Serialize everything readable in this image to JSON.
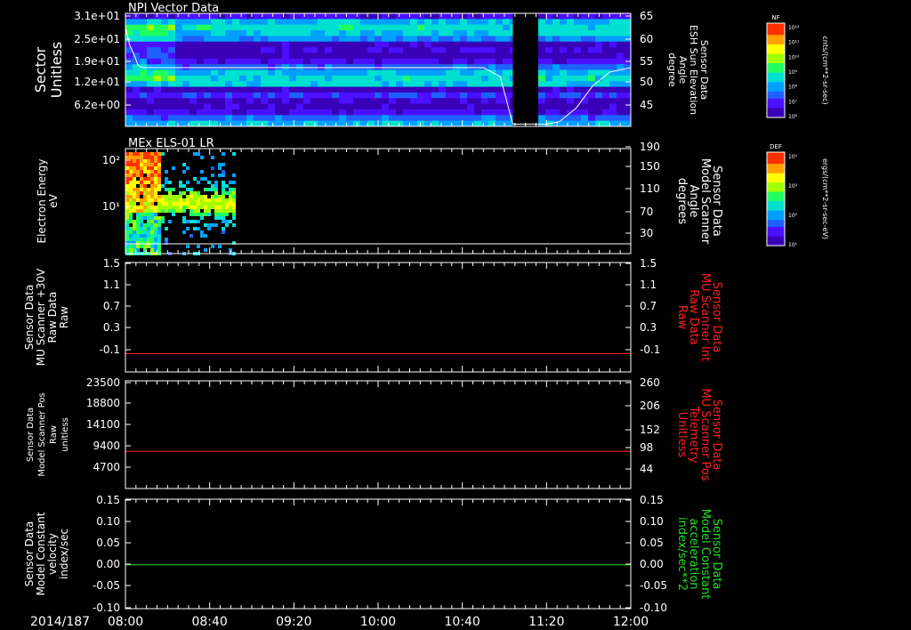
{
  "chart_data": [
    {
      "type": "heatmap",
      "title": "NPI Vector Data",
      "ylabel": "Sector\nUnitless",
      "yticks": [
        "3.1e+01",
        "2.5e+01",
        "1.9e+01",
        "1.2e+01",
        "6.2e+00"
      ],
      "y2label": "Sensor Data\nESH Sun Elevation\nAngle\ndegree",
      "y2ticks": [
        "65",
        "60",
        "55",
        "50",
        "45"
      ],
      "colorbar": {
        "label": "NF",
        "units": "cnts/(cm**2-sr-sec)",
        "ticks": [
          "10¹²",
          "10¹¹",
          "10¹⁰",
          "10⁹",
          "10⁸",
          "10⁷",
          "10⁶"
        ]
      },
      "data_gap": {
        "start": "11:04",
        "end": "11:14"
      },
      "overlay_line": {
        "name": "ESH Sun Elevation Angle",
        "x": [
          "08:00",
          "08:02",
          "08:04",
          "08:06",
          "08:08",
          "10:50",
          "10:58",
          "11:04",
          "11:14",
          "11:20",
          "11:26",
          "11:34",
          "11:42",
          "11:50",
          "12:00"
        ],
        "y": [
          62,
          58,
          56,
          53.5,
          53,
          53,
          51,
          40.5,
          40.5,
          40.5,
          41,
          44,
          49,
          52,
          53
        ]
      }
    },
    {
      "type": "heatmap",
      "title": "MEx ELS-01 LR",
      "ylabel": "Electron Energy\neV",
      "yticks": [
        "10²",
        "10¹"
      ],
      "y2label": "Sensor Data\nModel Scanner\nAngle\ndegrees",
      "y2ticks": [
        "190",
        "150",
        "110",
        "70",
        "30"
      ],
      "colorbar": {
        "label": "DEF",
        "units": "ergs/(cm**2-sr-sec-eV)",
        "ticks": [
          "10⁴",
          "10³",
          "10²",
          "10¹"
        ]
      },
      "data_extent": {
        "start": "08:00",
        "end": "08:52"
      },
      "overlay_line": {
        "name": "Model Scanner Angle",
        "x": [
          "08:00",
          "12:00"
        ],
        "y": [
          14,
          14
        ]
      }
    },
    {
      "type": "line",
      "ylabel": "Sensor Data\nMU Scanner +30V\nRaw Data\nRaw",
      "yticks": [
        "1.5",
        "1.1",
        "0.7",
        "0.3",
        "-0.1"
      ],
      "ylim": [
        -0.3,
        1.5
      ],
      "y2label": "Sensor Data\nMU Scanner Int\nRaw Data\nRaw",
      "y2ticks": [
        "1.5",
        "1.1",
        "0.7",
        "0.3",
        "-0.1"
      ],
      "series": [
        {
          "color": "#ff2020",
          "x": [
            "08:00",
            "12:00"
          ],
          "y": [
            0.0,
            0.0
          ]
        }
      ]
    },
    {
      "type": "line",
      "ylabel": "Sensor Data\nModel Scanner Pos\nRaw\nunitless",
      "yticks": [
        "23500",
        "18800",
        "14100",
        "9400",
        "4700"
      ],
      "ylim": [
        0,
        23500
      ],
      "y2label": "Sensor Data\nMU Scanner Pos\nTelemetry\nUnitless",
      "y2ticks": [
        "260",
        "206",
        "152",
        "98",
        "44"
      ],
      "series": [
        {
          "color": "#ff2020",
          "x": [
            "08:00",
            "12:00"
          ],
          "y": [
            8100,
            8100
          ]
        }
      ]
    },
    {
      "type": "line",
      "ylabel": "Sensor Data\nModel Constant\nvelocity\nindex/sec",
      "yticks": [
        "0.15",
        "0.10",
        "0.05",
        "0.00",
        "-0.05",
        "-0.10"
      ],
      "ylim": [
        -0.1,
        0.15
      ],
      "y2label": "Sensor Data\nModel Constant\nacceleration\nindex/sec**2",
      "y2ticks": [
        "0.15",
        "0.10",
        "0.05",
        "0.00",
        "-0.05",
        "-0.10"
      ],
      "series": [
        {
          "color": "#20e020",
          "x": [
            "08:00",
            "12:00"
          ],
          "y": [
            0.0,
            0.0
          ]
        }
      ]
    }
  ],
  "xaxis": {
    "date_label": "2014/187",
    "ticks": [
      "08:00",
      "08:40",
      "09:20",
      "10:00",
      "10:40",
      "11:20",
      "12:00"
    ]
  },
  "colors": {
    "background": "#000000",
    "axes": "#ffffff",
    "red_label": "#ff2020",
    "green_label": "#20e020"
  }
}
